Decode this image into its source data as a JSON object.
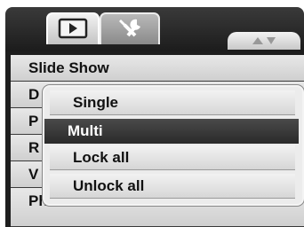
{
  "tabs": [
    {
      "name": "playback",
      "icon": "playback-icon",
      "active": true
    },
    {
      "name": "setup",
      "icon": "wrench-icon",
      "active": false
    }
  ],
  "page_indicator": {
    "icon": "up-down-arrows-icon"
  },
  "menu": {
    "items": [
      {
        "label": "Slide Show"
      },
      {
        "label": "D"
      },
      {
        "label": "P",
        "highlighted": true
      },
      {
        "label": "R"
      },
      {
        "label": "V"
      },
      {
        "label": "Photo Edit"
      }
    ]
  },
  "submenu": {
    "items": [
      {
        "label": "Single"
      },
      {
        "label": "Multi",
        "selected": true
      },
      {
        "label": "Lock all"
      },
      {
        "label": "Unlock all"
      }
    ]
  },
  "colors": {
    "selected_bg": "#333333",
    "row_bg": "#dcdcdc",
    "band": "#262626"
  }
}
